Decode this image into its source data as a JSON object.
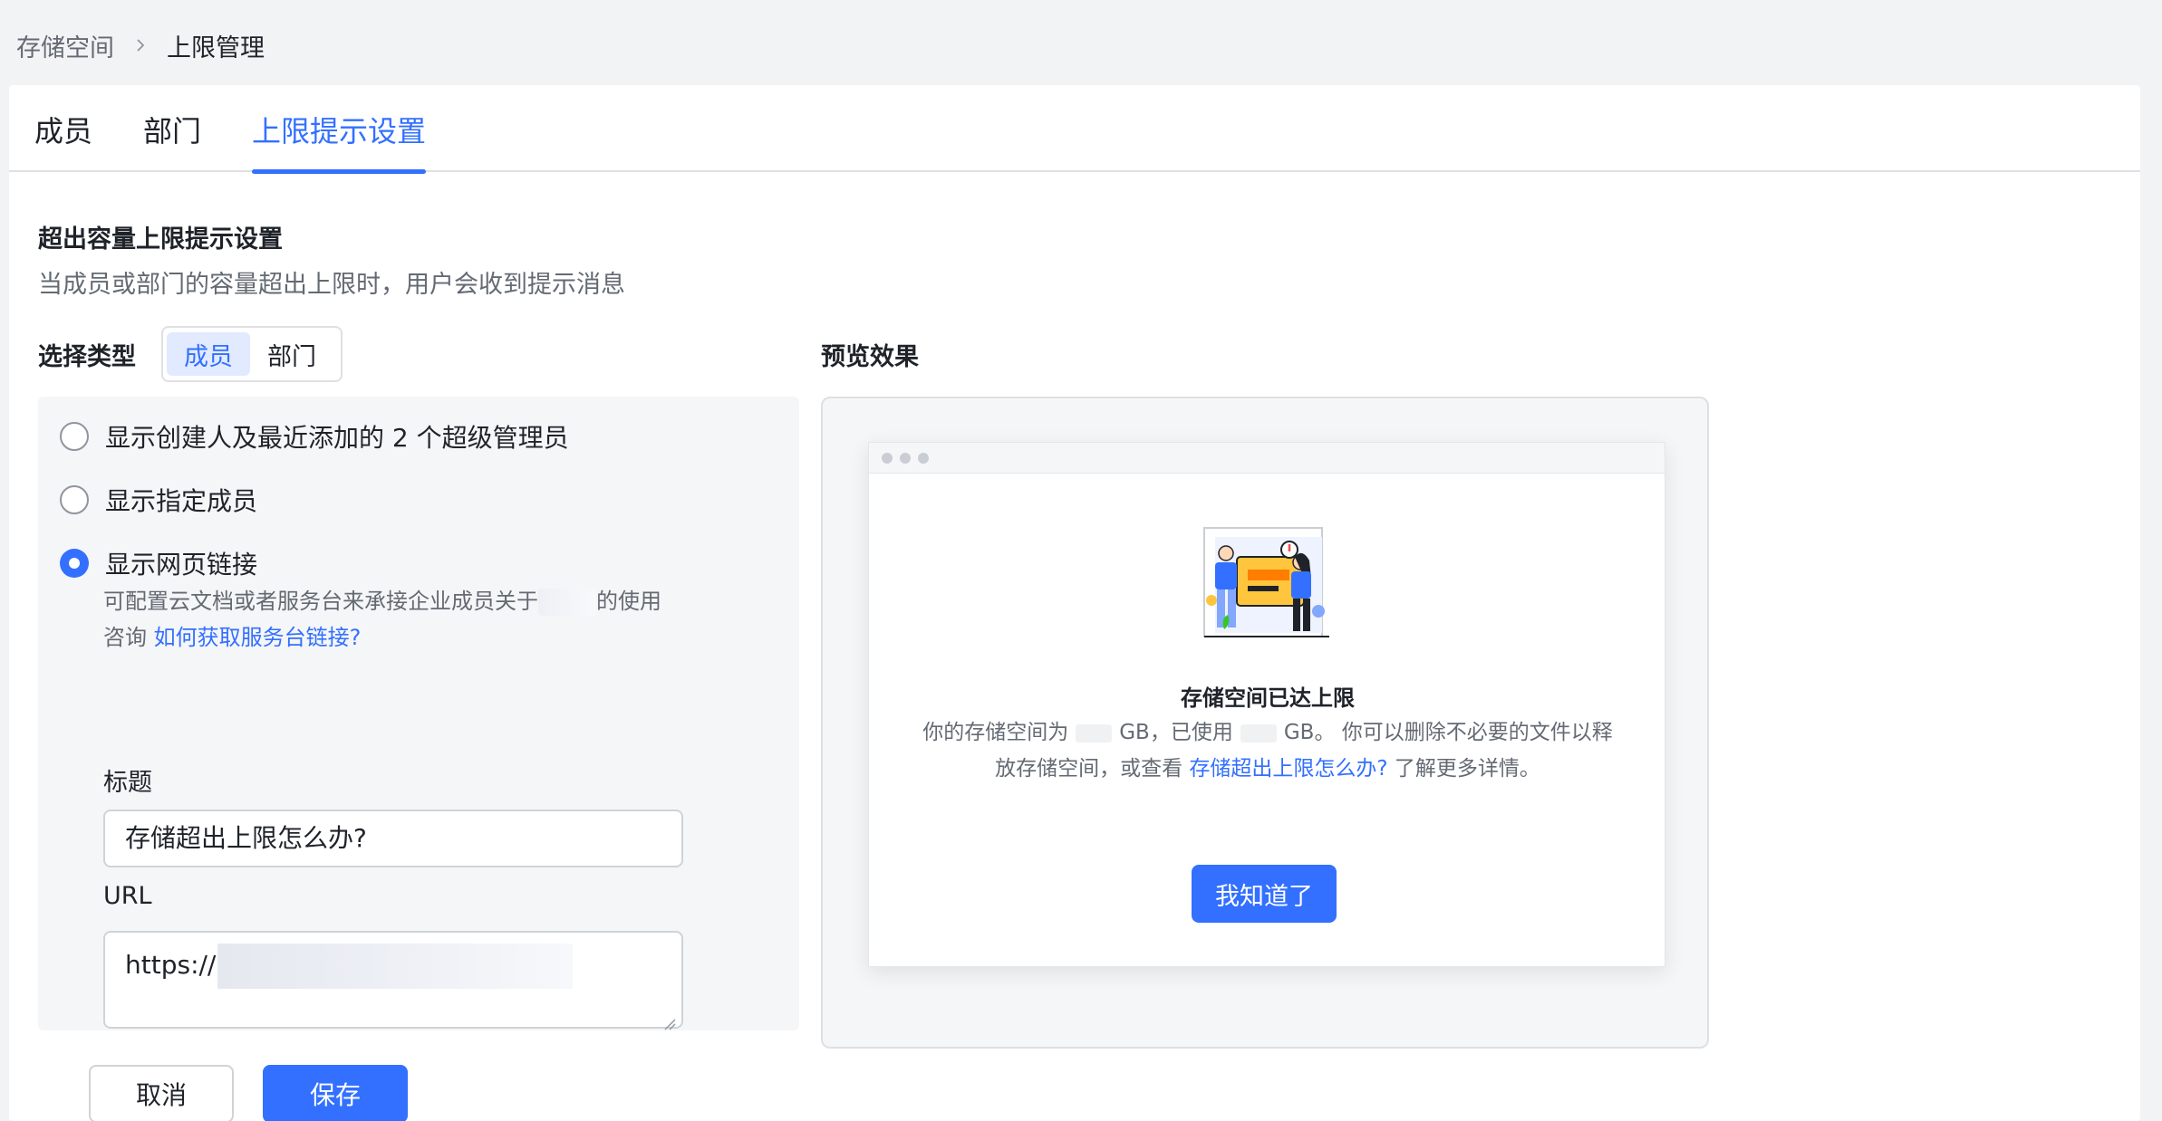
{
  "breadcrumb": {
    "root": "存储空间",
    "current": "上限管理"
  },
  "tabs": [
    {
      "label": "成员"
    },
    {
      "label": "部门"
    },
    {
      "label": "上限提示设置"
    }
  ],
  "section": {
    "title": "超出容量上限提示设置",
    "description": "当成员或部门的容量超出上限时，用户会收到提示消息"
  },
  "type_select": {
    "label": "选择类型",
    "options": [
      "成员",
      "部门"
    ],
    "selected": "成员"
  },
  "radios": [
    {
      "label": "显示创建人及最近添加的 2 个超级管理员",
      "checked": false
    },
    {
      "label": "显示指定成员",
      "checked": false
    },
    {
      "label": "显示网页链接",
      "checked": true
    }
  ],
  "hint": {
    "line1_prefix": "可配置云文档或者服务台来承接企业成员关于",
    "line1_suffix": "的使用",
    "line2_prefix": "咨询",
    "link": "如何获取服务台链接?"
  },
  "form": {
    "title_label": "标题",
    "title_value": "存储超出上限怎么办?",
    "url_label": "URL",
    "url_value": "https://"
  },
  "buttons": {
    "cancel": "取消",
    "save": "保存"
  },
  "preview": {
    "label": "预览效果",
    "dialog_title": "存储空间已达上限",
    "body_1": "你的存储空间为",
    "body_2": "GB，已使用",
    "body_3": "GB。 你可以删除不必要的文件以释",
    "body_4": "放存储空间，或查看",
    "body_link": "存储超出上限怎么办?",
    "body_5": "了解更多详情。",
    "ok_button": "我知道了"
  },
  "colors": {
    "accent": "#3370ff",
    "text": "#1f2329",
    "muted": "#646a73",
    "background": "#f2f3f5"
  }
}
